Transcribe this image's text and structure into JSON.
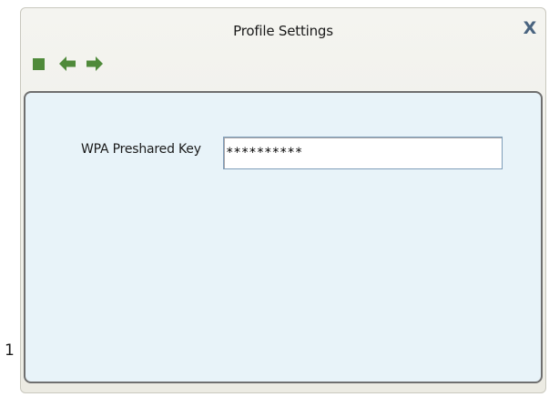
{
  "window": {
    "title": "Profile Settings",
    "close_label": "X"
  },
  "toolbar": {
    "buttons": [
      {
        "icon": "stop-icon",
        "color": "#4f8a3a"
      },
      {
        "icon": "arrow-left-icon",
        "color": "#4f8a3a"
      },
      {
        "icon": "arrow-right-icon",
        "color": "#4f8a3a"
      }
    ]
  },
  "form": {
    "wpa_key_label": "WPA Preshared Key",
    "wpa_key_value": "**********"
  },
  "stray_mark": "1",
  "colors": {
    "panel_bg": "#e8f3f9",
    "window_bg": "#ecebe3",
    "accent_green": "#4f8a3a",
    "close_x": "#4a6480"
  }
}
